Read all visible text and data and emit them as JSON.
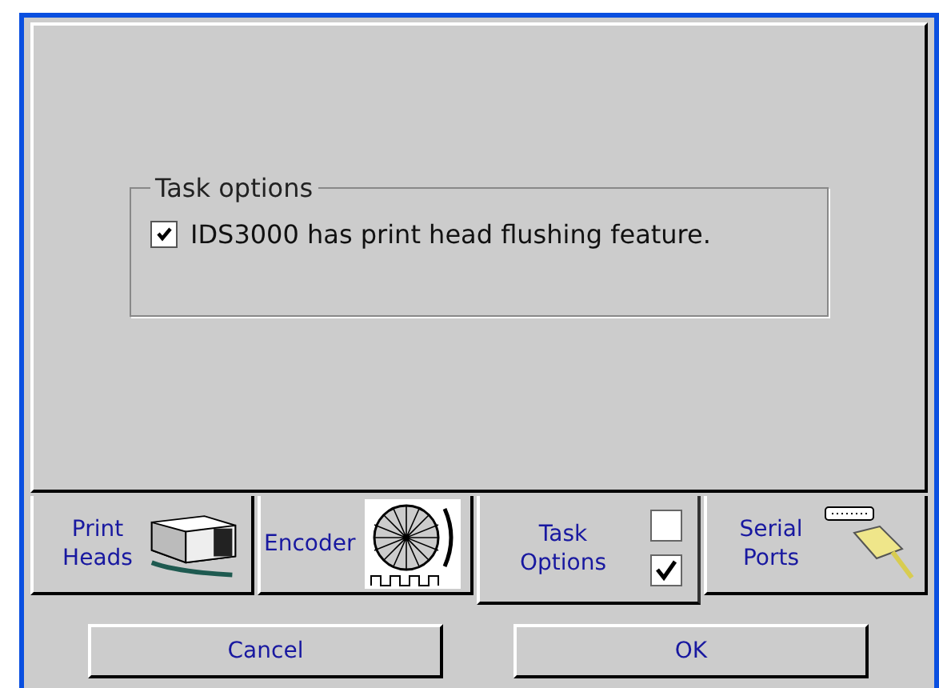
{
  "group": {
    "title": "Task options",
    "option": {
      "label": "IDS3000 has print head flushing feature.",
      "checked": true
    }
  },
  "tabs": [
    {
      "label": "Print Heads",
      "kind": "printhead",
      "selected": false
    },
    {
      "label": "Encoder",
      "kind": "encoder",
      "selected": false
    },
    {
      "label": "Task Options",
      "kind": "options",
      "selected": true
    },
    {
      "label": "Serial Ports",
      "kind": "serial",
      "selected": false
    }
  ],
  "buttons": [
    {
      "label": "Cancel"
    },
    {
      "label": "OK"
    }
  ]
}
